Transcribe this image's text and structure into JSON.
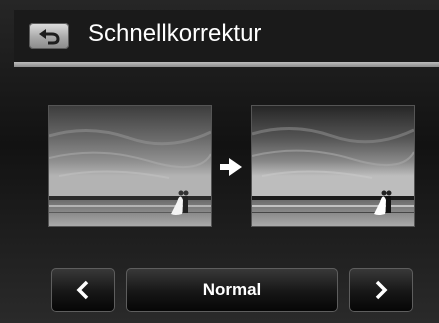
{
  "header": {
    "title": "Schnellkorrektur",
    "back_icon": "return-arrow-icon"
  },
  "preview": {
    "before_image": "beach-photo-original",
    "after_image": "beach-photo-corrected",
    "transition_icon": "right-arrow-icon"
  },
  "controls": {
    "prev_icon": "chevron-left-icon",
    "mode_label": "Normal",
    "next_icon": "chevron-right-icon"
  },
  "colors": {
    "background": "#1a1a1a",
    "header_line": "#a8a8a8",
    "text": "#ffffff"
  }
}
